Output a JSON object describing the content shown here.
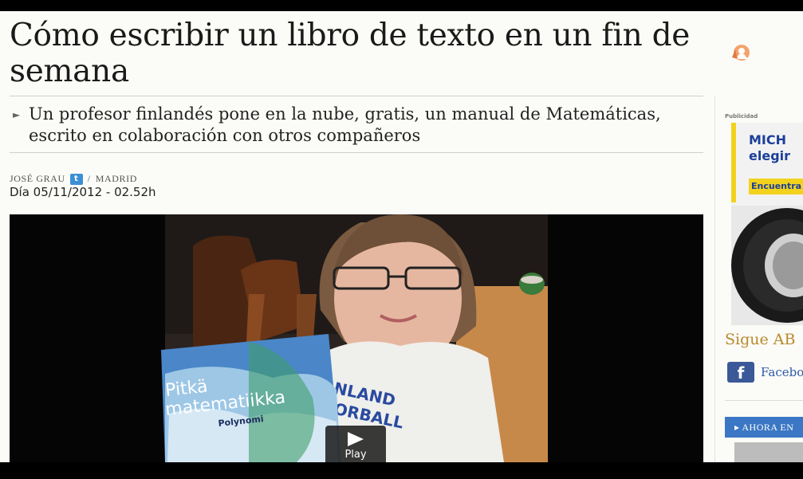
{
  "article": {
    "headline": "Cómo escribir un libro de texto en un fin de semana",
    "subhead": "Un profesor finlandés pone en la nube, gratis, un manual de Matemáticas, escrito en colaboración con otros compañeros",
    "author": "JOSÉ GRAU",
    "separator": "/",
    "location": "MADRID",
    "date": "Día 05/11/2012 - 02.52h"
  },
  "video": {
    "play_label": "Play",
    "book_title_line1": "Pitkä",
    "book_title_line2": "matematiikka",
    "book_subtitle": "Polynomi",
    "shirt_text_line1": "NLAND",
    "shirt_text_line2": "ORBALL"
  },
  "sidebar": {
    "ad_label": "Publicidad",
    "ad_title": "MICH elegir",
    "ad_cta": "Encuentra",
    "follow_title": "Sigue AB",
    "facebook_label": "Facebo",
    "ahora_label": "AHORA EN"
  },
  "icons": {
    "twitter": "twitter-icon",
    "facebook": "facebook-icon",
    "play": "play-icon",
    "subhead_arrow": "arrow-right-icon"
  },
  "colors": {
    "follow_gold": "#b88a2c",
    "facebook_blue": "#3b5998",
    "ahora_blue": "#3b77c4",
    "ad_yellow": "#f3d21d",
    "ad_blue": "#1c3f9a"
  }
}
